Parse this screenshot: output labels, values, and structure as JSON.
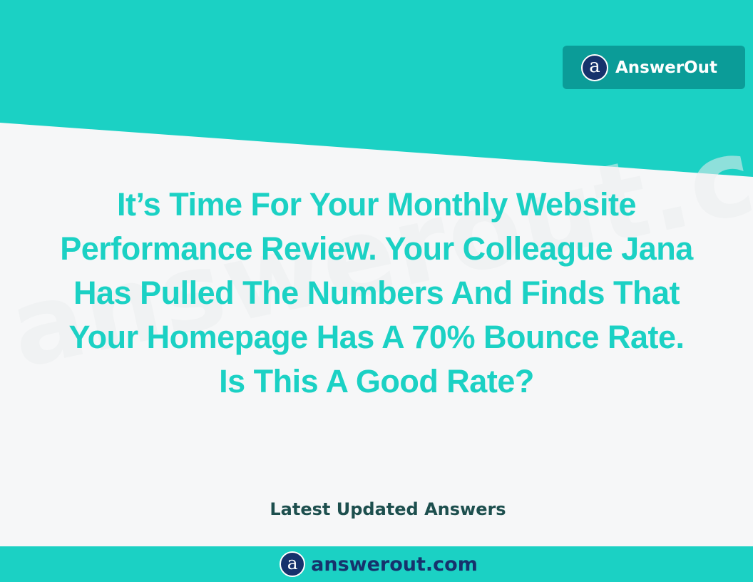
{
  "brand": {
    "name": "AnswerOut",
    "logo_glyph": "a",
    "logo_icon": "answerout-logo-icon"
  },
  "watermark": {
    "text": "answerout.com"
  },
  "question": {
    "lines": [
      "It’s Time For Your Monthly Website",
      "Performance Review. Your Colleague Jana",
      "Has Pulled The Numbers And Finds That",
      "Your Homepage Has A 70% Bounce Rate.",
      "Is This A Good Rate?"
    ]
  },
  "section_label": "Latest Updated Answers",
  "footer": {
    "logo_glyph": "a",
    "domain": "answerout.com"
  },
  "colors": {
    "teal": "#1bd1c4",
    "badge_teal": "#0b9c98",
    "navy": "#16326c",
    "dark_teal_text": "#1d4f4e",
    "background": "#f6f7f8"
  }
}
